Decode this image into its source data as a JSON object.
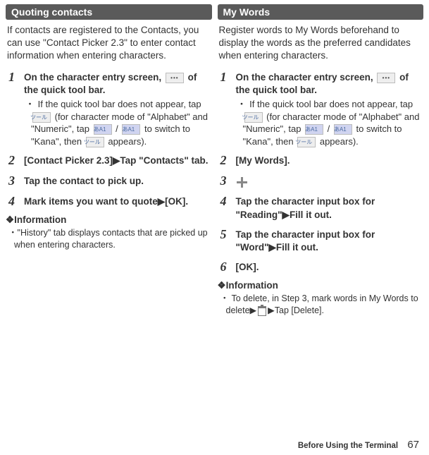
{
  "left": {
    "header": "Quoting contacts",
    "intro": "If contacts are registered to the Contacts, you can use \"Contact Picker 2.3\" to enter contact information when entering characters.",
    "steps": {
      "s1": {
        "num": "1",
        "title_a": "On the character entry screen, ",
        "title_b": " of the quick tool bar.",
        "sub_a": "If the quick tool bar does not appear, tap ",
        "sub_b": " (for character mode of \"Alphabet\" and \"Numeric\", tap ",
        "sub_c": " / ",
        "sub_d": " to switch to \"Kana\", then ",
        "sub_e": " appears)."
      },
      "s2": {
        "num": "2",
        "title": "[Contact Picker 2.3]▶Tap \"Contacts\" tab."
      },
      "s3": {
        "num": "3",
        "title": "Tap the contact to pick up."
      },
      "s4": {
        "num": "4",
        "title": "Mark items you want to quote▶[OK]."
      }
    },
    "info_head": "❖Information",
    "info1": "\"History\" tab displays contacts that are picked up when entering characters."
  },
  "right": {
    "header": "My Words",
    "intro": "Register words to My Words beforehand to display the words as the preferred candidates when entering characters.",
    "steps": {
      "s1": {
        "num": "1",
        "title_a": "On the character entry screen, ",
        "title_b": " of the quick tool bar.",
        "sub_a": "If the quick tool bar does not appear, tap ",
        "sub_b": " (for character mode of \"Alphabet\" and \"Numeric\", tap ",
        "sub_c": " / ",
        "sub_d": " to switch to \"Kana\", then ",
        "sub_e": " appears)."
      },
      "s2": {
        "num": "2",
        "title": "[My Words]."
      },
      "s3": {
        "num": "3"
      },
      "s4": {
        "num": "4",
        "title": "Tap the character input box for \"Reading\"▶Fill it out."
      },
      "s5": {
        "num": "5",
        "title": "Tap the character input box for \"Word\"▶Fill it out."
      },
      "s6": {
        "num": "6",
        "title": "[OK]."
      }
    },
    "info_head": "❖Information",
    "info1_a": "To delete, in Step 3, mark words in My Words to delete▶",
    "info1_b": "▶Tap [Delete]."
  },
  "keys": {
    "dots": "•••",
    "tool": "ツール",
    "kana1": "あA1",
    "kana2": "あA1"
  },
  "footer": {
    "section": "Before Using the Terminal",
    "page": "67"
  }
}
